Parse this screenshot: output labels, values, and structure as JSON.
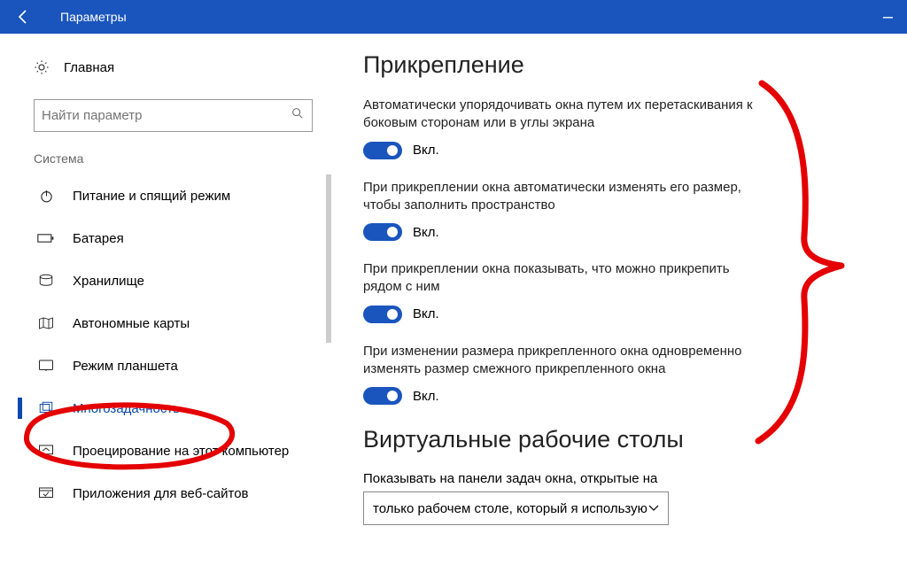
{
  "titlebar": {
    "title": "Параметры"
  },
  "sidebar": {
    "home_label": "Главная",
    "search_placeholder": "Найти параметр",
    "group_label": "Система",
    "items": [
      {
        "label": "Питание и спящий режим"
      },
      {
        "label": "Батарея"
      },
      {
        "label": "Хранилище"
      },
      {
        "label": "Автономные карты"
      },
      {
        "label": "Режим планшета"
      },
      {
        "label": "Многозадачность"
      },
      {
        "label": "Проецирование на этот компьютер"
      },
      {
        "label": "Приложения для веб-сайтов"
      }
    ]
  },
  "content": {
    "section1_title": "Прикрепление",
    "settings": [
      {
        "desc": "Автоматически упорядочивать окна путем их перетаскивания к боковым сторонам или в углы экрана",
        "state": "Вкл."
      },
      {
        "desc": "При прикреплении окна автоматически изменять его размер, чтобы заполнить пространство",
        "state": "Вкл."
      },
      {
        "desc": "При прикреплении окна показывать, что можно прикрепить рядом с ним",
        "state": "Вкл."
      },
      {
        "desc": "При изменении размера прикрепленного окна одновременно изменять размер смежного прикрепленного окна",
        "state": "Вкл."
      }
    ],
    "section2_title": "Виртуальные рабочие столы",
    "desktop_label": "Показывать на панели задач окна, открытые на",
    "desktop_value": "только рабочем столе, который я использую"
  }
}
